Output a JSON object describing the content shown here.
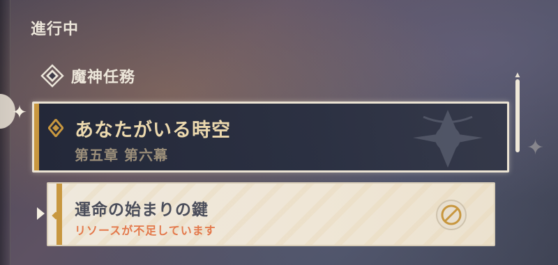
{
  "section": {
    "title": "進行中"
  },
  "category": {
    "icon": "archon-quest-icon",
    "label": "魔神任務"
  },
  "quests": [
    {
      "title": "あなたがいる時空",
      "subtitle": "第五章 第六幕",
      "state": "selected",
      "accent_color": "#c8973f"
    },
    {
      "title": "運命の始まりの鍵",
      "status": "リソースが不足しています",
      "state": "unavailable",
      "status_color": "#e3784a",
      "icon": "blocked-icon"
    }
  ],
  "colors": {
    "selected_card_bg": "#232a3c",
    "card_border": "#ebe3d3",
    "light_card_bg": "#efe8dc",
    "title_gold": "#ecd9ae"
  }
}
